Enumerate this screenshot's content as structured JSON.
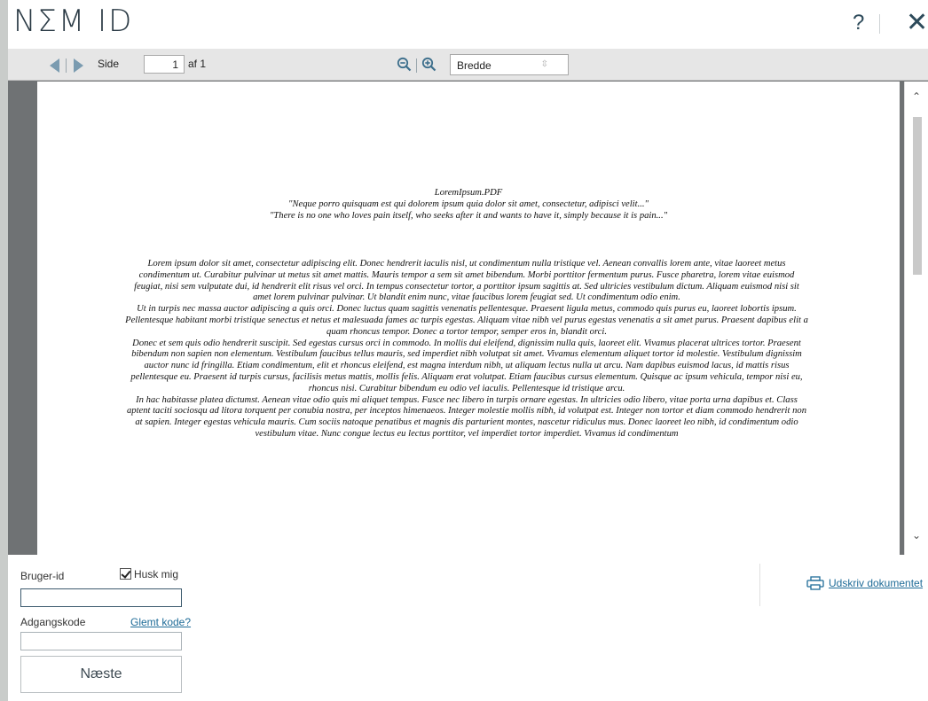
{
  "header": {
    "logo": "NΣM ID",
    "help_label": "?",
    "close_label": "✕"
  },
  "toolbar": {
    "page_label": "Side",
    "page_value": "1",
    "of_label": "af 1",
    "zoom_value": "Bredde",
    "zoom_caret": "⇳"
  },
  "document": {
    "filename": "LoremIpsum.PDF",
    "quote1": "\"Neque porro quisquam est qui dolorem ipsum quia dolor sit amet, consectetur, adipisci velit...\"",
    "quote2": "\"There is no one who loves pain itself, who seeks after it and wants to have it, simply because it is pain...\"",
    "paragraphs": [
      "Lorem ipsum dolor sit amet, consectetur adipiscing elit. Donec hendrerit iaculis nisl, ut condimentum nulla tristique vel. Aenean convallis lorem ante, vitae laoreet metus condimentum ut. Curabitur pulvinar ut metus sit amet mattis. Mauris tempor a sem sit amet bibendum. Morbi porttitor fermentum purus. Fusce pharetra, lorem vitae euismod feugiat, nisi sem vulputate dui, id hendrerit elit risus vel orci. In tempus consectetur tortor, a porttitor ipsum sagittis at. Sed ultricies vestibulum dictum. Aliquam euismod nisi sit amet lorem pulvinar pulvinar. Ut blandit enim nunc, vitae faucibus lorem feugiat sed. Ut condimentum odio enim.",
      "Ut in turpis nec massa auctor adipiscing a quis orci. Donec luctus quam sagittis venenatis pellentesque. Praesent ligula metus, commodo quis purus eu, laoreet lobortis ipsum. Pellentesque habitant morbi tristique senectus et netus et malesuada fames ac turpis egestas. Aliquam vitae nibh vel purus egestas venenatis a sit amet purus. Praesent dapibus elit a quam rhoncus tempor. Donec a tortor tempor, semper eros in, blandit orci.",
      "Donec et sem quis odio hendrerit suscipit. Sed egestas cursus orci in commodo. In mollis dui eleifend, dignissim nulla quis, laoreet elit. Vivamus placerat ultrices tortor. Praesent bibendum non sapien non elementum. Vestibulum faucibus tellus mauris, sed imperdiet nibh volutpat sit amet. Vivamus elementum aliquet tortor id molestie. Vestibulum dignissim auctor nunc id fringilla. Etiam condimentum, elit et rhoncus eleifend, est magna interdum nibh, ut aliquam lectus nulla ut arcu. Nam dapibus euismod lacus, id mattis risus pellentesque eu. Praesent id turpis cursus, facilisis metus mattis, mollis felis. Aliquam erat volutpat. Etiam faucibus cursus elementum. Quisque ac ipsum vehicula, tempor nisi eu, rhoncus nisi. Curabitur bibendum eu odio vel iaculis. Pellentesque id tristique arcu.",
      "In hac habitasse platea dictumst. Aenean vitae odio quis mi aliquet tempus. Fusce nec libero in turpis ornare egestas. In ultricies odio libero, vitae porta urna dapibus et. Class aptent taciti sociosqu ad litora torquent per conubia nostra, per inceptos himenaeos. Integer molestie mollis nibh, id volutpat est. Integer non tortor et diam commodo hendrerit non at sapien. Integer egestas vehicula mauris. Cum sociis natoque penatibus et magnis dis parturient montes, nascetur ridiculus mus. Donec laoreet leo nibh, id condimentum odio vestibulum vitae. Nunc congue lectus eu lectus porttitor, vel imperdiet tortor imperdiet. Vivamus id condimentum"
    ]
  },
  "login": {
    "user_label": "Bruger-id",
    "remember_label": "Husk mig",
    "user_value": "",
    "password_label": "Adgangskode",
    "forgot_label": "Glemt kode?",
    "password_value": "",
    "next_label": "Næste"
  },
  "print": {
    "label": "Udskriv dokumentet"
  },
  "colors": {
    "accent": "#1f6c98",
    "arrow": "#7a9bb0",
    "viewer_bg": "#6f7274"
  }
}
